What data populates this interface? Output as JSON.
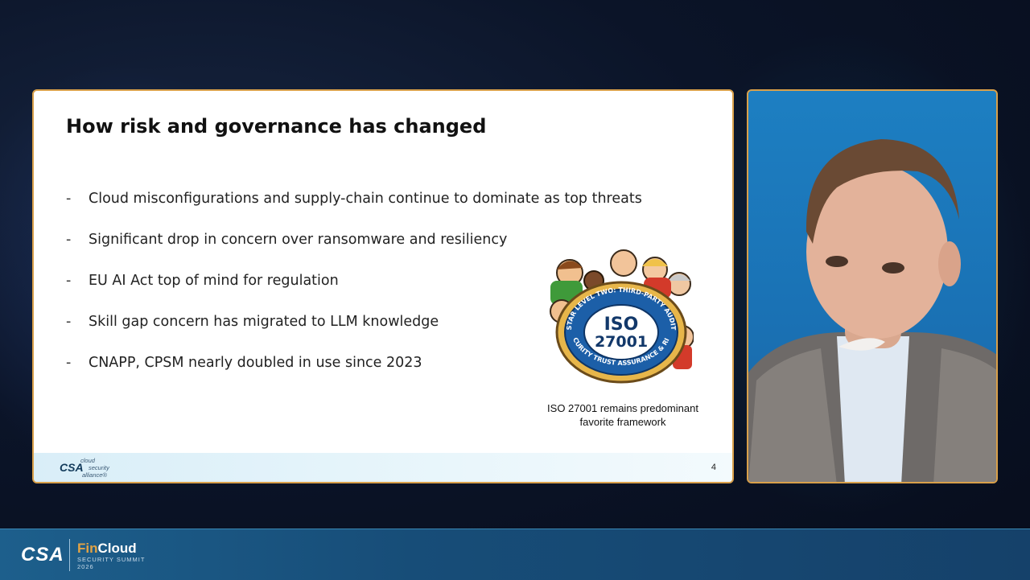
{
  "slide": {
    "title": "How risk and governance has changed",
    "bullets": [
      "Cloud misconfigurations and supply-chain continue to dominate as top threats",
      "Significant drop in concern over ransomware and resiliency",
      "EU AI Act top of mind for regulation",
      "Skill gap concern has migrated to LLM knowledge",
      "CNAPP, CPSM nearly doubled in use since 2023"
    ],
    "bullet_marker": "-",
    "badge": {
      "line1": "ISO",
      "line2": "27001",
      "arc_top": "STAR LEVEL TWO: THIRD-PARTY AUDIT",
      "arc_bottom": "SECURITY TRUST ASSURANCE & RISK"
    },
    "caption_line1": "ISO 27001 remains predominant",
    "caption_line2": "favorite framework",
    "footer": {
      "logo": "CSA",
      "logo_line1": "cloud",
      "logo_line2": "security",
      "logo_line3": "alliance®",
      "page_number": "4"
    }
  },
  "bottom_bar": {
    "logo": "CSA",
    "event_fin": "Fin",
    "event_cloud": "Cloud",
    "event_sub": "SECURITY SUMMIT",
    "event_year": "2026"
  },
  "colors": {
    "frame_border": "#d9a04a",
    "video_bg": "#1d7fc2",
    "bar_bg": "#1d5f8c",
    "badge_blue": "#1c5fa8",
    "badge_gold": "#e7b64a"
  }
}
